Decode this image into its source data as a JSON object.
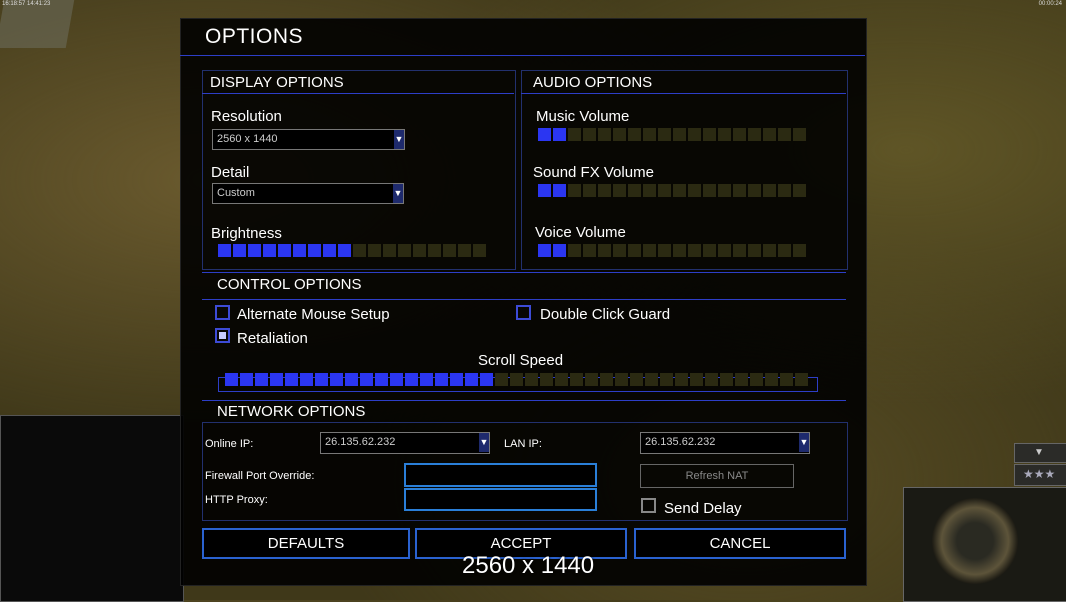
{
  "topbar": {
    "left_text": "16:18:57 14:41:23",
    "right_text": "00:00:24"
  },
  "dialog": {
    "title": "OPTIONS",
    "display": {
      "heading": "DISPLAY OPTIONS",
      "resolution_label": "Resolution",
      "resolution_value": "2560 x 1440",
      "detail_label": "Detail",
      "detail_value": "Custom",
      "brightness_label": "Brightness",
      "brightness_level": 0.5
    },
    "audio": {
      "heading": "AUDIO OPTIONS",
      "music_label": "Music Volume",
      "music_level": 0.1,
      "sfx_label": "Sound FX Volume",
      "sfx_level": 0.1,
      "voice_label": "Voice Volume",
      "voice_level": 0.1
    },
    "control": {
      "heading": "CONTROL OPTIONS",
      "alt_mouse_label": "Alternate Mouse Setup",
      "alt_mouse_checked": false,
      "double_click_label": "Double Click Guard",
      "double_click_checked": false,
      "retaliation_label": "Retaliation",
      "retaliation_checked": true,
      "scroll_label": "Scroll Speed",
      "scroll_level": 0.47
    },
    "network": {
      "heading": "NETWORK OPTIONS",
      "online_ip_label": "Online IP:",
      "online_ip_value": "26.135.62.232",
      "lan_ip_label": "LAN IP:",
      "lan_ip_value": "26.135.62.232",
      "firewall_label": "Firewall Port Override:",
      "proxy_label": "HTTP Proxy:",
      "refresh_nat_label": "Refresh NAT",
      "send_delay_label": "Send Delay",
      "send_delay_checked": false
    },
    "buttons": {
      "defaults": "DEFAULTS",
      "accept": "ACCEPT",
      "cancel": "CANCEL"
    }
  },
  "caption": "2560 x 1440",
  "colors": {
    "accent": "#2b36f2",
    "border": "#2a62d0",
    "slider_off": "#2b2a12"
  },
  "icons": {
    "dropdown": "chevron-down-icon",
    "hud_arrow": "triangle-down-icon",
    "hud_rank": "star-icon"
  }
}
